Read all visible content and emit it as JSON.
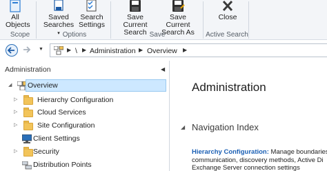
{
  "ribbon": {
    "all_objects": [
      "All",
      "Objects"
    ],
    "saved_searches": [
      "Saved",
      "Searches"
    ],
    "search_settings": [
      "Search",
      "Settings"
    ],
    "save_current_search": [
      "Save Current",
      "Search"
    ],
    "save_current_search_as": [
      "Save Current",
      "Search As"
    ],
    "close": "Close",
    "groups": {
      "scope": "Scope",
      "options": "Options",
      "save": "Save",
      "active_search": "Active Search"
    }
  },
  "addressbar": {
    "root": "\\",
    "crumbs": [
      "Administration",
      "Overview"
    ]
  },
  "leftpane": {
    "title": "Administration",
    "tree": [
      {
        "label": "Overview",
        "selected": true
      },
      {
        "label": "Hierarchy Configuration"
      },
      {
        "label": "Cloud Services"
      },
      {
        "label": "Site Configuration"
      },
      {
        "label": "Client Settings"
      },
      {
        "label": "Security"
      },
      {
        "label": "Distribution Points"
      }
    ]
  },
  "rightpane": {
    "title": "Administration",
    "section": "Navigation Index",
    "desc_link": "Hierarchy Configuration:",
    "desc_line1": " Manage boundaries",
    "desc_line2": "communication, discovery methods, Active Di",
    "desc_line3": "Exchange Server connection settings"
  },
  "colors": {
    "accent": "#1a5fb4",
    "selection": "#cde8ff",
    "folder": "#f2c45a",
    "ribbon_bg": "#f3f5f8"
  }
}
